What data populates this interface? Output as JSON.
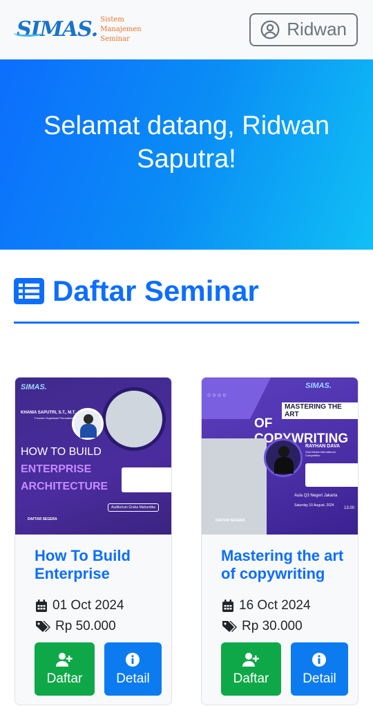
{
  "brand": {
    "logo_text": "SIMAS.",
    "sub_lines": [
      "Sistem",
      "Manajemen",
      "Seminar"
    ]
  },
  "navbar": {
    "user_label": "Ridwan"
  },
  "hero": {
    "title": "Selamat datang, Ridwan Saputra!"
  },
  "section": {
    "title": "Daftar Seminar"
  },
  "seminars": [
    {
      "title": "How To Build Enterprise",
      "date": "01 Oct 2024",
      "price": "Rp 50.000",
      "register_label": "Daftar",
      "detail_label": "Detail",
      "poster": {
        "speaker": "KHANIA SAPUTRI, S.T., M.T.",
        "speaker_role": "Founder Organisasi Perusahaan",
        "line1": "HOW TO BUILD",
        "line2": "ENTERPRISE",
        "line3": "ARCHITECTURE",
        "venue": "Auditorium Graha Mahardika",
        "cta": "DAFTAR SEGERA"
      }
    },
    {
      "title": "Mastering the art of copywriting",
      "date": "16 Oct 2024",
      "price": "Rp 30.000",
      "register_label": "Daftar",
      "detail_label": "Detail",
      "poster": {
        "banner": "MASTERING THE ART",
        "headline": "OF COPYWRITING",
        "speaker": "RAYHAN DAVA",
        "speaker_role": "Gold Medal International Competition",
        "venue": "Aula Q3 Negeri Jakarta",
        "date": "Saturday 10 August, 2024",
        "time": "13.00",
        "cta": "DAFTAR SEGERA"
      }
    }
  ],
  "colors": {
    "primary": "#0d6efd",
    "success": "#0fa848",
    "muted": "#6c757d"
  }
}
